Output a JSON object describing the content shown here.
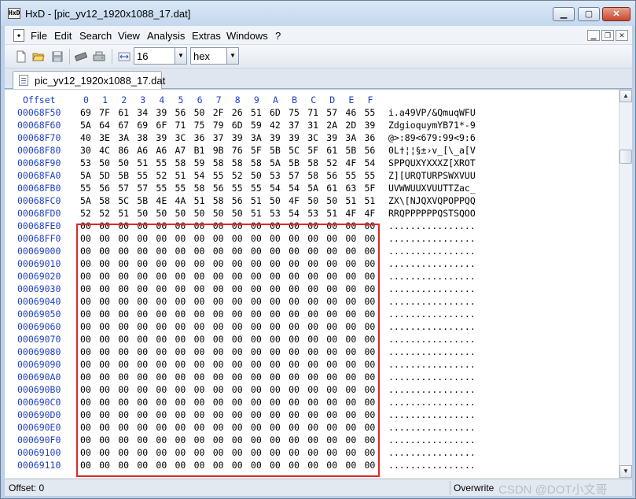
{
  "window": {
    "title": "HxD - [pic_yv12_1920x1088_17.dat]",
    "app_icon_text": "HxD",
    "controls": {
      "minimize": "▁",
      "maximize": "▢",
      "close": "✕"
    }
  },
  "menu": {
    "items": [
      "File",
      "Edit",
      "Search",
      "View",
      "Analysis",
      "Extras",
      "Windows",
      "?"
    ],
    "mdi_controls": [
      "▁",
      "❐",
      "✕"
    ]
  },
  "toolbar": {
    "icons": [
      "new-file-icon",
      "open-folder-icon",
      "save-disk-icon",
      "ram-chip-icon",
      "disk-drive-icon",
      "bytes-per-row-icon"
    ],
    "bytes_per_row": "16",
    "display_mode": "hex"
  },
  "tab": {
    "label": "pic_yv12_1920x1088_17.dat"
  },
  "editor": {
    "header": {
      "offset_label": "Offset",
      "columns": [
        "0",
        "1",
        "2",
        "3",
        "4",
        "5",
        "6",
        "7",
        "8",
        "9",
        "A",
        "B",
        "C",
        "D",
        "E",
        "F"
      ]
    },
    "rows": [
      {
        "addr": "00068F50",
        "hex": [
          "69",
          "7F",
          "61",
          "34",
          "39",
          "56",
          "50",
          "2F",
          "26",
          "51",
          "6D",
          "75",
          "71",
          "57",
          "46",
          "55"
        ],
        "text": "i.a49VP/&QmuqWFU"
      },
      {
        "addr": "00068F60",
        "hex": [
          "5A",
          "64",
          "67",
          "69",
          "6F",
          "71",
          "75",
          "79",
          "6D",
          "59",
          "42",
          "37",
          "31",
          "2A",
          "2D",
          "39"
        ],
        "text": "ZdgioquymYB71*-9"
      },
      {
        "addr": "00068F70",
        "hex": [
          "40",
          "3E",
          "3A",
          "38",
          "39",
          "3C",
          "36",
          "37",
          "39",
          "3A",
          "39",
          "39",
          "3C",
          "39",
          "3A",
          "36"
        ],
        "text": "@>:89<679:99<9:6"
      },
      {
        "addr": "00068F80",
        "hex": [
          "30",
          "4C",
          "86",
          "A6",
          "A6",
          "A7",
          "B1",
          "9B",
          "76",
          "5F",
          "5B",
          "5C",
          "5F",
          "61",
          "5B",
          "56"
        ],
        "text": "0L†¦¦§±›v_[\\_a[V"
      },
      {
        "addr": "00068F90",
        "hex": [
          "53",
          "50",
          "50",
          "51",
          "55",
          "58",
          "59",
          "58",
          "58",
          "58",
          "5A",
          "5B",
          "58",
          "52",
          "4F",
          "54"
        ],
        "text": "SPPQUXYXXXZ[XROT"
      },
      {
        "addr": "00068FA0",
        "hex": [
          "5A",
          "5D",
          "5B",
          "55",
          "52",
          "51",
          "54",
          "55",
          "52",
          "50",
          "53",
          "57",
          "58",
          "56",
          "55",
          "55"
        ],
        "text": "Z][URQTURPSWXVUU"
      },
      {
        "addr": "00068FB0",
        "hex": [
          "55",
          "56",
          "57",
          "57",
          "55",
          "55",
          "58",
          "56",
          "55",
          "55",
          "54",
          "54",
          "5A",
          "61",
          "63",
          "5F"
        ],
        "text": "UVWWUUXVUUTTZac_"
      },
      {
        "addr": "00068FC0",
        "hex": [
          "5A",
          "58",
          "5C",
          "5B",
          "4E",
          "4A",
          "51",
          "58",
          "56",
          "51",
          "50",
          "4F",
          "50",
          "50",
          "51",
          "51"
        ],
        "text": "ZX\\[NJQXVQPOPPQQ"
      },
      {
        "addr": "00068FD0",
        "hex": [
          "52",
          "52",
          "51",
          "50",
          "50",
          "50",
          "50",
          "50",
          "50",
          "51",
          "53",
          "54",
          "53",
          "51",
          "4F",
          "4F"
        ],
        "text": "RRQPPPPPPQSTSQOO"
      },
      {
        "addr": "00068FE0",
        "hex": [
          "00",
          "00",
          "00",
          "00",
          "00",
          "00",
          "00",
          "00",
          "00",
          "00",
          "00",
          "00",
          "00",
          "00",
          "00",
          "00"
        ],
        "text": "................"
      },
      {
        "addr": "00068FF0",
        "hex": [
          "00",
          "00",
          "00",
          "00",
          "00",
          "00",
          "00",
          "00",
          "00",
          "00",
          "00",
          "00",
          "00",
          "00",
          "00",
          "00"
        ],
        "text": "................"
      },
      {
        "addr": "00069000",
        "hex": [
          "00",
          "00",
          "00",
          "00",
          "00",
          "00",
          "00",
          "00",
          "00",
          "00",
          "00",
          "00",
          "00",
          "00",
          "00",
          "00"
        ],
        "text": "................"
      },
      {
        "addr": "00069010",
        "hex": [
          "00",
          "00",
          "00",
          "00",
          "00",
          "00",
          "00",
          "00",
          "00",
          "00",
          "00",
          "00",
          "00",
          "00",
          "00",
          "00"
        ],
        "text": "................"
      },
      {
        "addr": "00069020",
        "hex": [
          "00",
          "00",
          "00",
          "00",
          "00",
          "00",
          "00",
          "00",
          "00",
          "00",
          "00",
          "00",
          "00",
          "00",
          "00",
          "00"
        ],
        "text": "................"
      },
      {
        "addr": "00069030",
        "hex": [
          "00",
          "00",
          "00",
          "00",
          "00",
          "00",
          "00",
          "00",
          "00",
          "00",
          "00",
          "00",
          "00",
          "00",
          "00",
          "00"
        ],
        "text": "................"
      },
      {
        "addr": "00069040",
        "hex": [
          "00",
          "00",
          "00",
          "00",
          "00",
          "00",
          "00",
          "00",
          "00",
          "00",
          "00",
          "00",
          "00",
          "00",
          "00",
          "00"
        ],
        "text": "................"
      },
      {
        "addr": "00069050",
        "hex": [
          "00",
          "00",
          "00",
          "00",
          "00",
          "00",
          "00",
          "00",
          "00",
          "00",
          "00",
          "00",
          "00",
          "00",
          "00",
          "00"
        ],
        "text": "................"
      },
      {
        "addr": "00069060",
        "hex": [
          "00",
          "00",
          "00",
          "00",
          "00",
          "00",
          "00",
          "00",
          "00",
          "00",
          "00",
          "00",
          "00",
          "00",
          "00",
          "00"
        ],
        "text": "................"
      },
      {
        "addr": "00069070",
        "hex": [
          "00",
          "00",
          "00",
          "00",
          "00",
          "00",
          "00",
          "00",
          "00",
          "00",
          "00",
          "00",
          "00",
          "00",
          "00",
          "00"
        ],
        "text": "................"
      },
      {
        "addr": "00069080",
        "hex": [
          "00",
          "00",
          "00",
          "00",
          "00",
          "00",
          "00",
          "00",
          "00",
          "00",
          "00",
          "00",
          "00",
          "00",
          "00",
          "00"
        ],
        "text": "................"
      },
      {
        "addr": "00069090",
        "hex": [
          "00",
          "00",
          "00",
          "00",
          "00",
          "00",
          "00",
          "00",
          "00",
          "00",
          "00",
          "00",
          "00",
          "00",
          "00",
          "00"
        ],
        "text": "................"
      },
      {
        "addr": "000690A0",
        "hex": [
          "00",
          "00",
          "00",
          "00",
          "00",
          "00",
          "00",
          "00",
          "00",
          "00",
          "00",
          "00",
          "00",
          "00",
          "00",
          "00"
        ],
        "text": "................"
      },
      {
        "addr": "000690B0",
        "hex": [
          "00",
          "00",
          "00",
          "00",
          "00",
          "00",
          "00",
          "00",
          "00",
          "00",
          "00",
          "00",
          "00",
          "00",
          "00",
          "00"
        ],
        "text": "................"
      },
      {
        "addr": "000690C0",
        "hex": [
          "00",
          "00",
          "00",
          "00",
          "00",
          "00",
          "00",
          "00",
          "00",
          "00",
          "00",
          "00",
          "00",
          "00",
          "00",
          "00"
        ],
        "text": "................"
      },
      {
        "addr": "000690D0",
        "hex": [
          "00",
          "00",
          "00",
          "00",
          "00",
          "00",
          "00",
          "00",
          "00",
          "00",
          "00",
          "00",
          "00",
          "00",
          "00",
          "00"
        ],
        "text": "................"
      },
      {
        "addr": "000690E0",
        "hex": [
          "00",
          "00",
          "00",
          "00",
          "00",
          "00",
          "00",
          "00",
          "00",
          "00",
          "00",
          "00",
          "00",
          "00",
          "00",
          "00"
        ],
        "text": "................"
      },
      {
        "addr": "000690F0",
        "hex": [
          "00",
          "00",
          "00",
          "00",
          "00",
          "00",
          "00",
          "00",
          "00",
          "00",
          "00",
          "00",
          "00",
          "00",
          "00",
          "00"
        ],
        "text": "................"
      },
      {
        "addr": "00069100",
        "hex": [
          "00",
          "00",
          "00",
          "00",
          "00",
          "00",
          "00",
          "00",
          "00",
          "00",
          "00",
          "00",
          "00",
          "00",
          "00",
          "00"
        ],
        "text": "................"
      },
      {
        "addr": "00069110",
        "hex": [
          "00",
          "00",
          "00",
          "00",
          "00",
          "00",
          "00",
          "00",
          "00",
          "00",
          "00",
          "00",
          "00",
          "00",
          "00",
          "00"
        ],
        "text": "................"
      }
    ],
    "scrollbar": {
      "up": "▲",
      "down": "▼"
    }
  },
  "status": {
    "offset": "Offset: 0",
    "mode": "Overwrite",
    "watermark": "CSDN @DOT小文哥"
  },
  "colors": {
    "address": "#1f3fc4",
    "highlight": "#e02828"
  }
}
